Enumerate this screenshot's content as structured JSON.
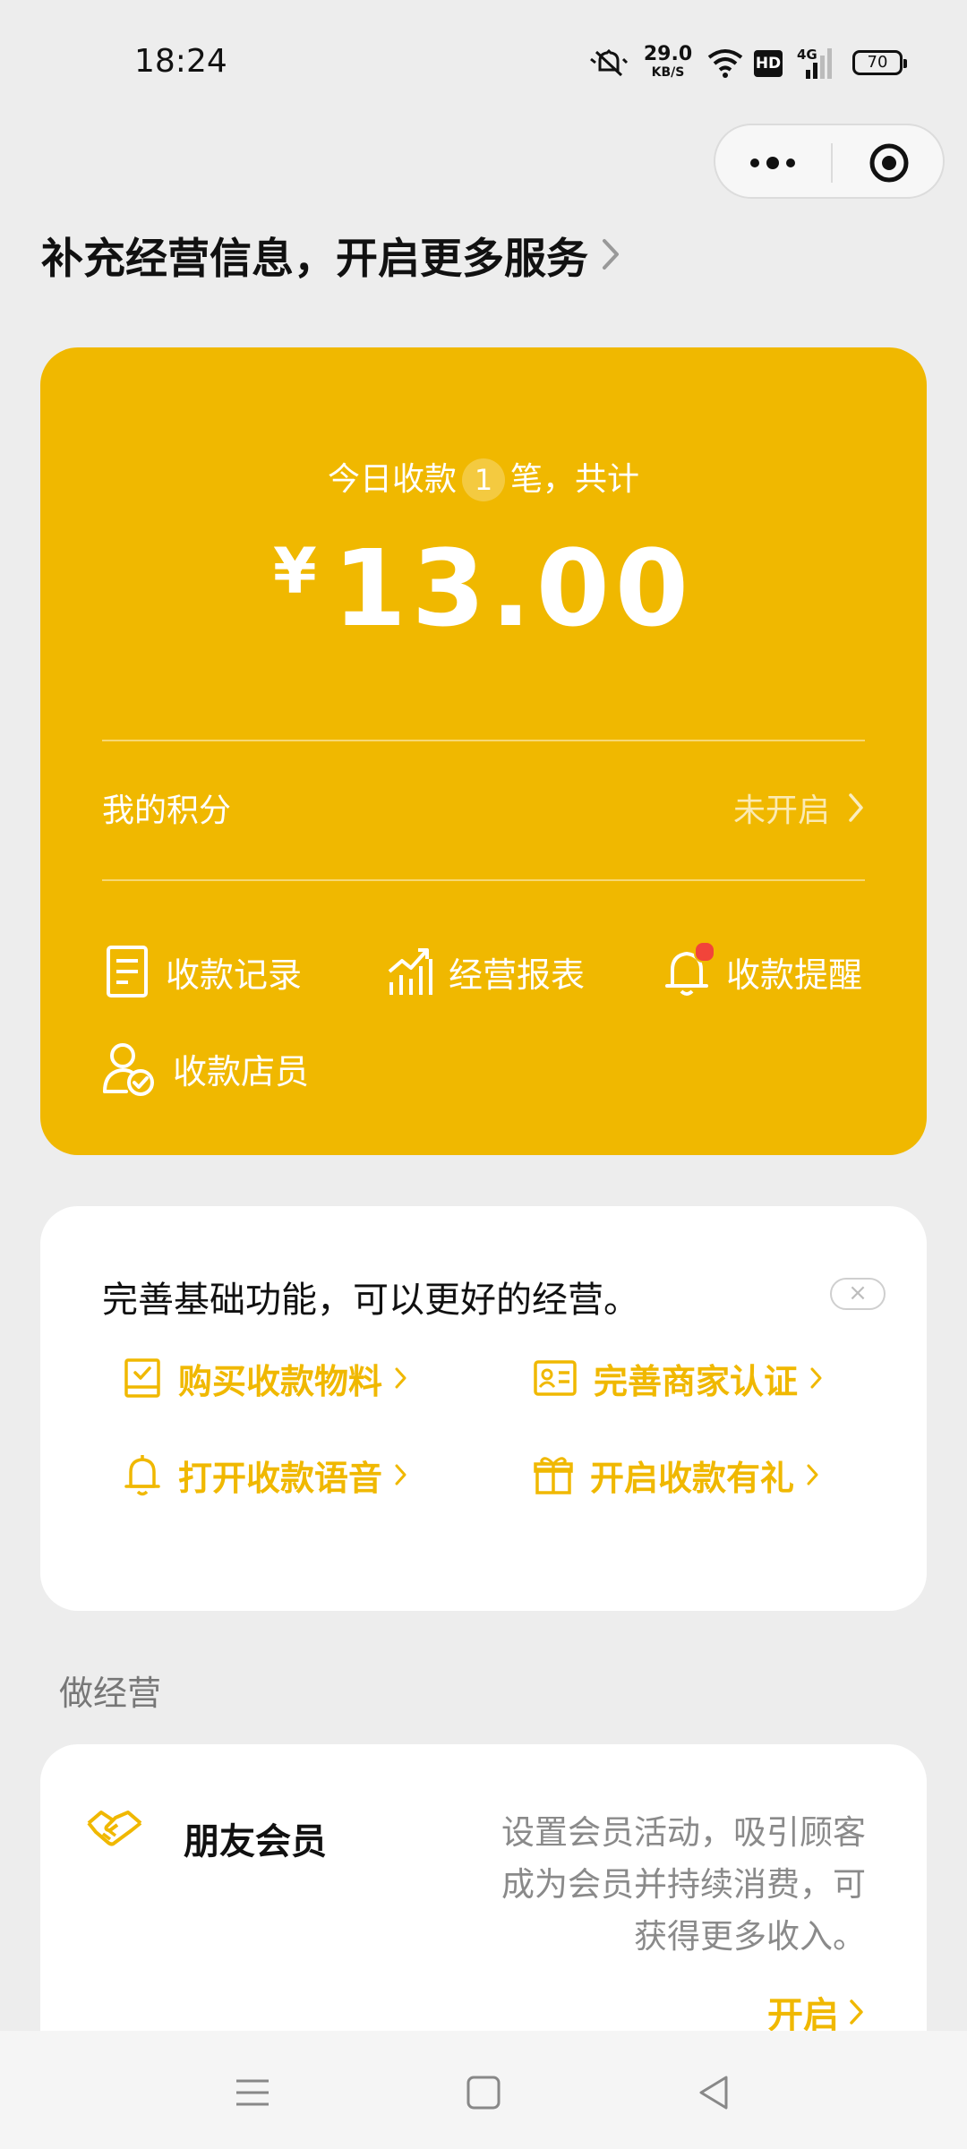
{
  "status_bar": {
    "time": "18:24",
    "net_speed_value": "29.0",
    "net_speed_unit": "KB/S",
    "hd_label": "HD",
    "network_type": "4G",
    "battery": "70"
  },
  "header": {
    "link_text": "补充经营信息，开启更多服务"
  },
  "summary_card": {
    "today_prefix": "今日收款",
    "today_count": "1",
    "today_suffix": "笔，共计",
    "currency": "¥",
    "amount": "13.00",
    "points_label": "我的积分",
    "points_status": "未开启",
    "tools": [
      {
        "label": "收款记录",
        "icon": "receipt-list-icon"
      },
      {
        "label": "经营报表",
        "icon": "bar-chart-icon"
      },
      {
        "label": "收款提醒",
        "icon": "bell-icon"
      },
      {
        "label": "收款店员",
        "icon": "staff-check-icon"
      }
    ]
  },
  "basic_card": {
    "title": "完善基础功能，可以更好的经营。",
    "close": "×",
    "features": [
      {
        "label": "购买收款物料",
        "icon": "checklist-icon"
      },
      {
        "label": "完善商家认证",
        "icon": "id-card-icon"
      },
      {
        "label": "打开收款语音",
        "icon": "bell-icon"
      },
      {
        "label": "开启收款有礼",
        "icon": "gift-icon"
      }
    ]
  },
  "section": {
    "label": "做经营"
  },
  "member_card": {
    "title": "朋友会员",
    "description": "设置会员活动，吸引顾客成为会员并持续消费，可获得更多收入。",
    "action": "开启"
  },
  "colors": {
    "accent": "#f0b800",
    "background": "#ededed",
    "badge_red": "#f2443a"
  }
}
